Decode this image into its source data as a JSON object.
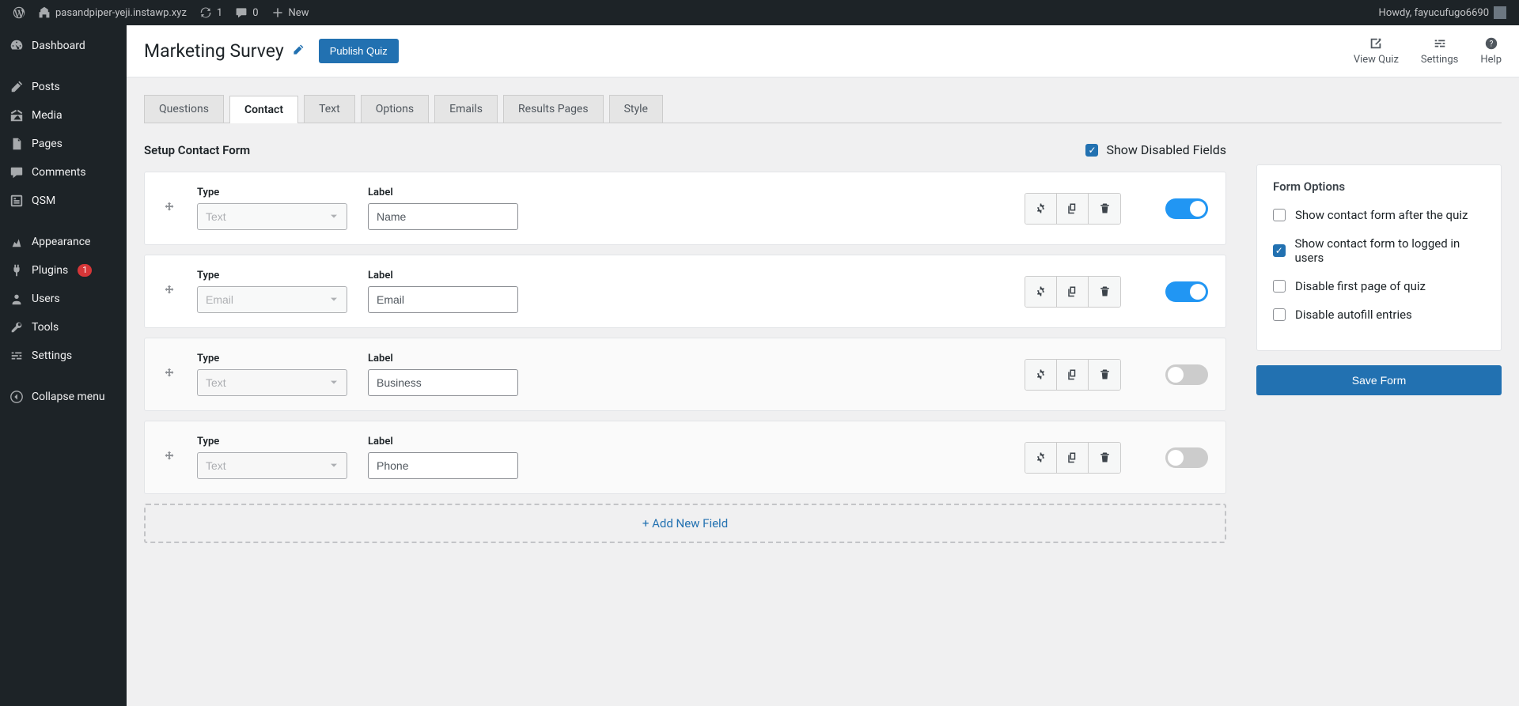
{
  "adminBar": {
    "siteName": "pasandpiper-yeji.instawp.xyz",
    "refreshCount": "1",
    "commentsCount": "0",
    "newLabel": "New",
    "howdy": "Howdy, fayucufugo6690"
  },
  "sidebar": {
    "items": [
      {
        "label": "Dashboard"
      },
      {
        "label": "Posts"
      },
      {
        "label": "Media"
      },
      {
        "label": "Pages"
      },
      {
        "label": "Comments"
      },
      {
        "label": "QSM"
      },
      {
        "label": "Appearance"
      },
      {
        "label": "Plugins",
        "badge": "1"
      },
      {
        "label": "Users"
      },
      {
        "label": "Tools"
      },
      {
        "label": "Settings"
      },
      {
        "label": "Collapse menu"
      }
    ]
  },
  "page": {
    "title": "Marketing Survey",
    "publish": "Publish Quiz",
    "viewQuiz": "View Quiz",
    "settings": "Settings",
    "help": "Help"
  },
  "tabs": [
    "Questions",
    "Contact",
    "Text",
    "Options",
    "Emails",
    "Results Pages",
    "Style"
  ],
  "section": {
    "title": "Setup Contact Form",
    "showDisabled": "Show Disabled Fields",
    "addField": "+ Add New Field",
    "typeHead": "Type",
    "labelHead": "Label"
  },
  "fields": [
    {
      "type": "Text",
      "label": "Name",
      "enabled": true
    },
    {
      "type": "Email",
      "label": "Email",
      "enabled": true
    },
    {
      "type": "Text",
      "label": "Business",
      "enabled": false
    },
    {
      "type": "Text",
      "label": "Phone",
      "enabled": false
    }
  ],
  "formOptions": {
    "title": "Form Options",
    "opts": [
      {
        "label": "Show contact form after the quiz",
        "checked": false
      },
      {
        "label": "Show contact form to logged in users",
        "checked": true
      },
      {
        "label": "Disable first page of quiz",
        "checked": false
      },
      {
        "label": "Disable autofill entries",
        "checked": false
      }
    ],
    "save": "Save Form"
  }
}
